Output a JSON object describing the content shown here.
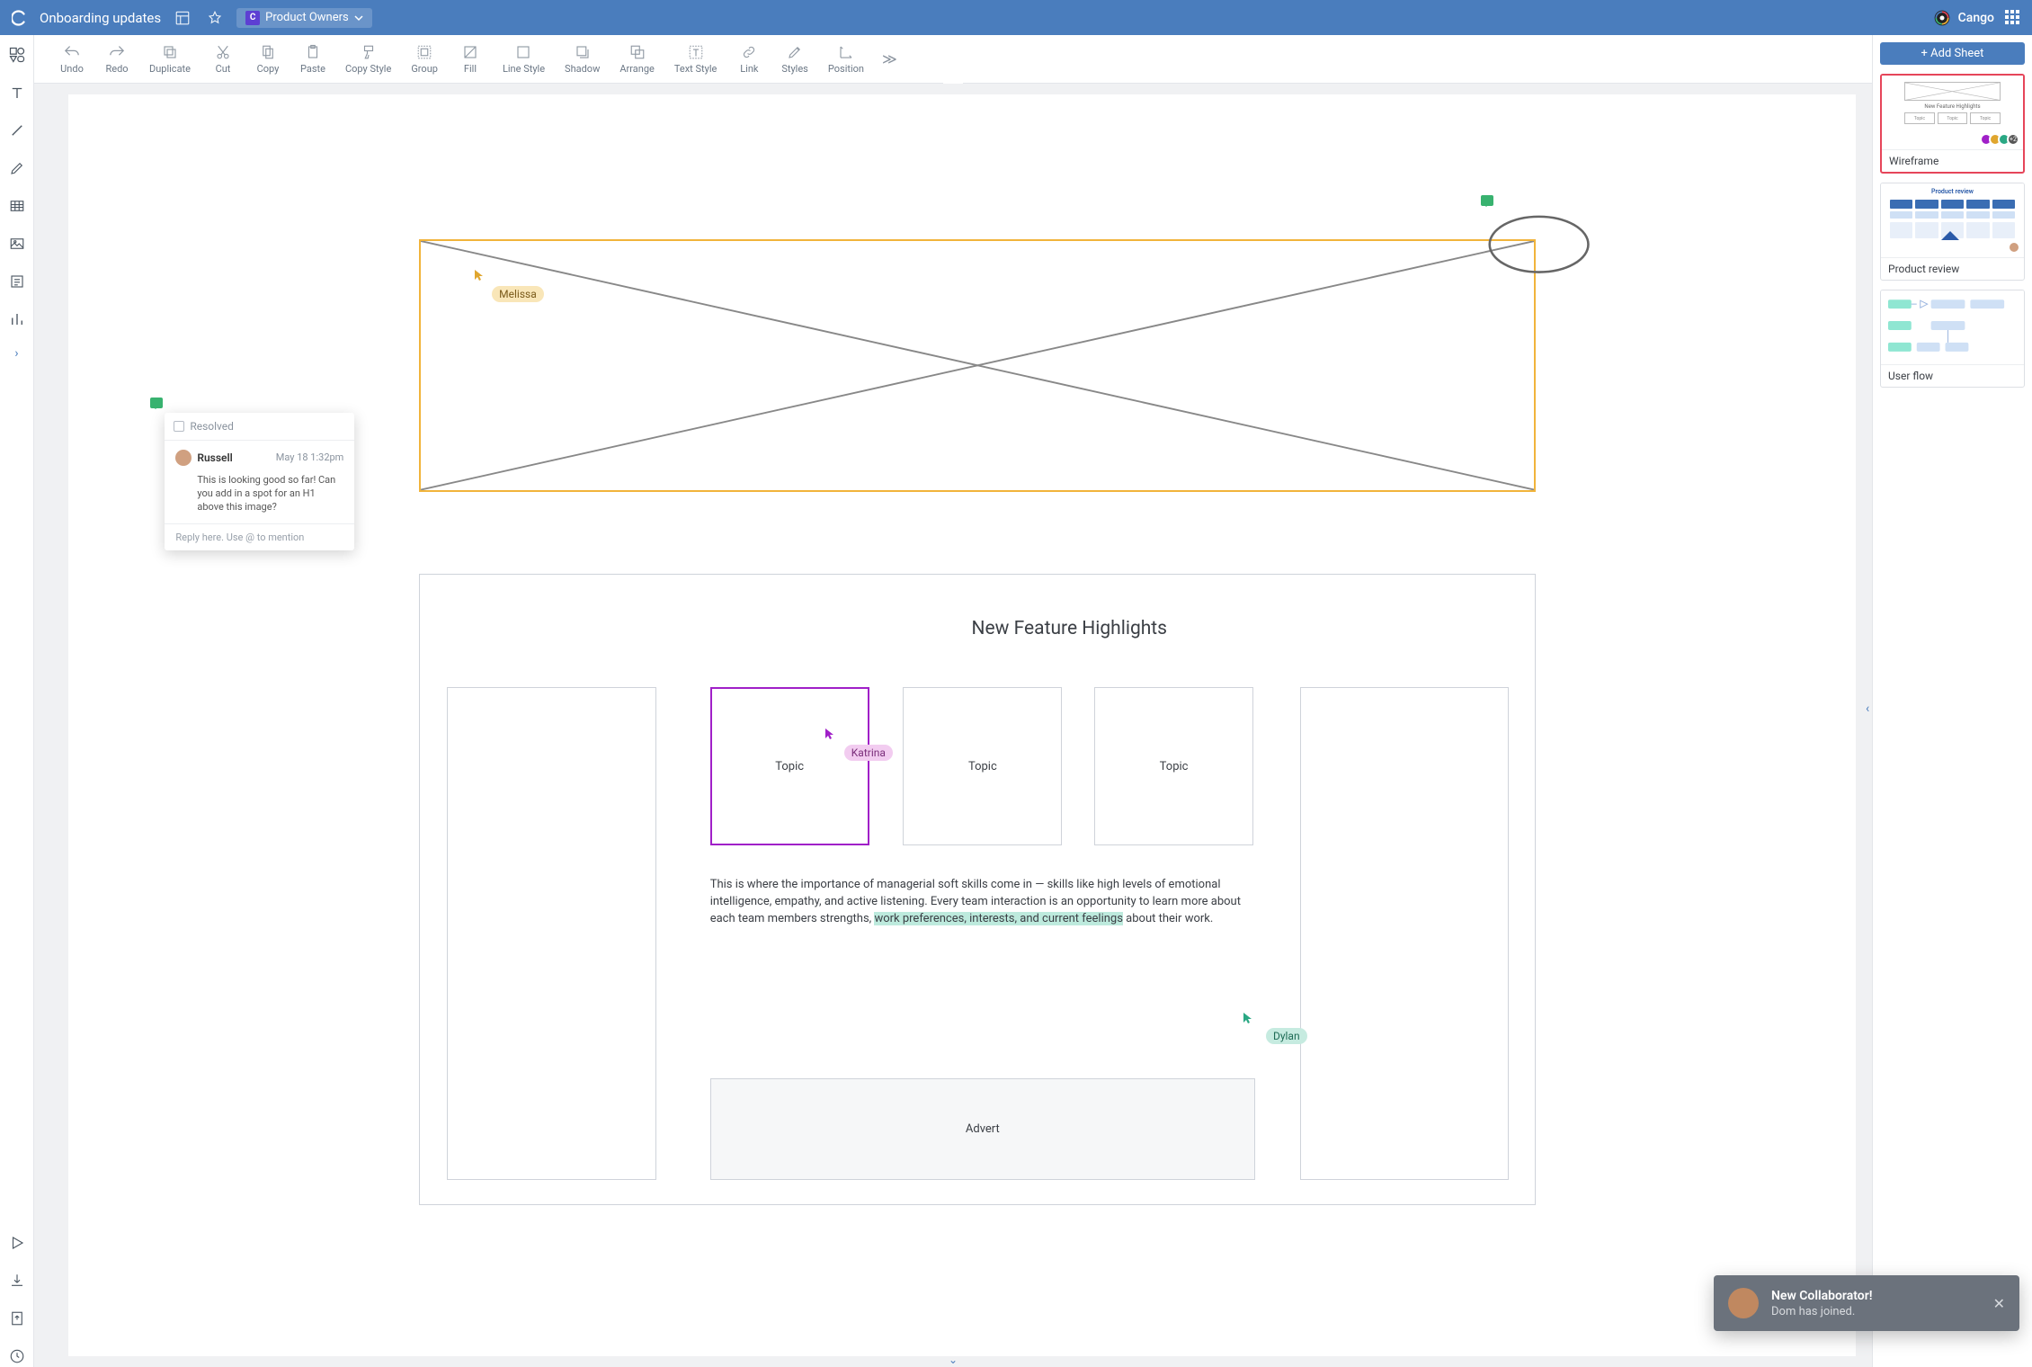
{
  "topbar": {
    "title": "Onboarding updates",
    "share_badge": "C",
    "share_label": "Product Owners",
    "brand": "Cango"
  },
  "toolbar": {
    "items": [
      {
        "id": "undo",
        "label": "Undo"
      },
      {
        "id": "redo",
        "label": "Redo"
      },
      {
        "id": "duplicate",
        "label": "Duplicate"
      },
      {
        "id": "cut",
        "label": "Cut"
      },
      {
        "id": "copy",
        "label": "Copy"
      },
      {
        "id": "paste",
        "label": "Paste"
      },
      {
        "id": "copystyle",
        "label": "Copy Style"
      },
      {
        "id": "group",
        "label": "Group"
      },
      {
        "id": "fill",
        "label": "Fill"
      },
      {
        "id": "linestyle",
        "label": "Line Style"
      },
      {
        "id": "shadow",
        "label": "Shadow"
      },
      {
        "id": "arrange",
        "label": "Arrange"
      },
      {
        "id": "textstyle",
        "label": "Text Style"
      },
      {
        "id": "link",
        "label": "Link"
      },
      {
        "id": "styles",
        "label": "Styles"
      },
      {
        "id": "position",
        "label": "Position"
      }
    ]
  },
  "cursors": {
    "melissa": "Melissa",
    "katrina": "Katrina",
    "dylan": "Dylan"
  },
  "wireframe": {
    "heading": "New Feature Highlights",
    "topics": [
      "Topic",
      "Topic",
      "Topic"
    ],
    "body_pre": "This is where the importance of managerial soft skills come in — skills like high levels of emotional intelligence, empathy, and active listening. Every team interaction is an opportunity to learn more about each team members strengths, ",
    "body_hl": "work preferences, interests, and current feelings",
    "body_post": " about their work.",
    "advert": "Advert"
  },
  "comment": {
    "resolved_label": "Resolved",
    "author": "Russell",
    "timestamp": "May 18 1:32pm",
    "message": "This is looking good so far! Can you add in a spot for an H1 above this image?",
    "reply_placeholder": "Reply here. Use @ to mention"
  },
  "rightpanel": {
    "add_sheet": "+ Add Sheet",
    "sheets": [
      {
        "id": "wireframe",
        "label": "Wireframe",
        "thumb_title": "New Feature Highlights",
        "avatar_overflow": "+2"
      },
      {
        "id": "product-review",
        "label": "Product review",
        "thumb_title": "Product review"
      },
      {
        "id": "user-flow",
        "label": "User flow"
      }
    ]
  },
  "toast": {
    "title": "New Collaborator!",
    "body": "Dom has joined."
  },
  "colors": {
    "brand": "#4a7dbd",
    "selection": "#f1b43b",
    "katrina": "#a020c8",
    "highlight": "#bdeadd",
    "comment_marker": "#38b26f",
    "active_sheet_border": "#e6455a"
  }
}
